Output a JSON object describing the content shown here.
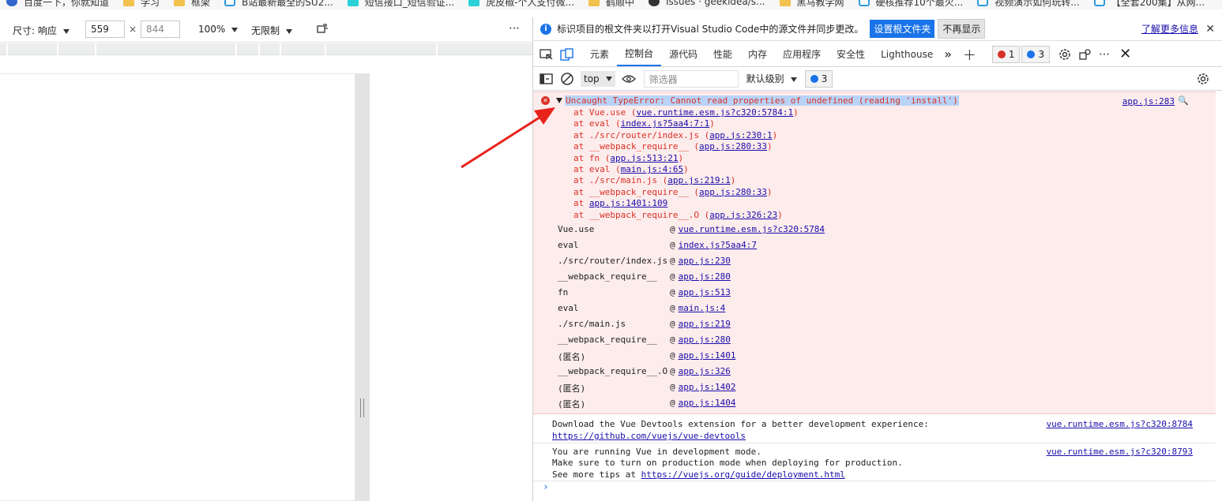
{
  "bookmarks": [
    "百度一下，你就知道",
    "学习",
    "框架",
    "B站最新最全的SU2...",
    "短信接口_短信验证...",
    "虎皮椒-个人支付微...",
    "鹤顺中",
    "Issues · geekidea/s...",
    "黑马教学网",
    "硬核推荐10个最火...",
    "视频演示如何玩转...",
    "【全套200集】从网..."
  ],
  "emulation": {
    "size_label": "尺寸: 响应",
    "width_value": "559",
    "times": "×",
    "height_placeholder": "844",
    "zoom": "100%",
    "throttle": "无限制"
  },
  "info_bar": {
    "message": "标识项目的根文件夹以打开Visual Studio Code中的源文件并同步更改。",
    "set_root_button": "设置根文件夹",
    "dismiss_button": "不再显示",
    "learn_more": "了解更多信息",
    "close": "✕"
  },
  "tabs": [
    "元素",
    "控制台",
    "源代码",
    "性能",
    "内存",
    "应用程序",
    "安全性",
    "Lighthouse"
  ],
  "active_tab": "控制台",
  "badges": {
    "errors": "1",
    "issues": "3"
  },
  "filter_bar": {
    "context": "top",
    "filter_placeholder": "筛选器",
    "level": "默认级别",
    "issues_count": "3"
  },
  "console": {
    "error_message": "Uncaught TypeError: Cannot read properties of undefined (reading 'install')",
    "error_source": "app.js:283",
    "trace": [
      {
        "pre": "at Vue.use (",
        "link": "vue.runtime.esm.js?c320:5784:1",
        "post": ")"
      },
      {
        "pre": "at eval (",
        "link": "index.js?5aa4:7:1",
        "post": ")"
      },
      {
        "pre": "at ./src/router/index.js (",
        "link": "app.js:230:1",
        "post": ")"
      },
      {
        "pre": "at __webpack_require__ (",
        "link": "app.js:280:33",
        "post": ")"
      },
      {
        "pre": "at fn (",
        "link": "app.js:513:21",
        "post": ")"
      },
      {
        "pre": "at eval (",
        "link": "main.js:4:65",
        "post": ")"
      },
      {
        "pre": "at ./src/main.js (",
        "link": "app.js:219:1",
        "post": ")"
      },
      {
        "pre": "at __webpack_require__ (",
        "link": "app.js:280:33",
        "post": ")"
      },
      {
        "pre": "at ",
        "link": "app.js:1401:109",
        "post": ""
      },
      {
        "pre": "at __webpack_require__.O (",
        "link": "app.js:326:23",
        "post": ")"
      }
    ],
    "stack": [
      {
        "fn": "Vue.use",
        "loc": "vue.runtime.esm.js?c320:5784"
      },
      {
        "fn": "eval",
        "loc": "index.js?5aa4:7"
      },
      {
        "fn": "./src/router/index.js",
        "loc": "app.js:230"
      },
      {
        "fn": "__webpack_require__",
        "loc": "app.js:280"
      },
      {
        "fn": "fn",
        "loc": "app.js:513"
      },
      {
        "fn": "eval",
        "loc": "main.js:4"
      },
      {
        "fn": "./src/main.js",
        "loc": "app.js:219"
      },
      {
        "fn": "__webpack_require__",
        "loc": "app.js:280"
      },
      {
        "fn": "(匿名)",
        "loc": "app.js:1401"
      },
      {
        "fn": "__webpack_require__.O",
        "loc": "app.js:326"
      },
      {
        "fn": "(匿名)",
        "loc": "app.js:1402"
      },
      {
        "fn": "(匿名)",
        "loc": "app.js:1404"
      }
    ],
    "log1_line1": "Download the Vue Devtools extension for a better development experience:",
    "log1_link": "https://github.com/vuejs/vue-devtools",
    "log1_source": "vue.runtime.esm.js?c320:8784",
    "log2_line1": "You are running Vue in development mode.",
    "log2_line2": "Make sure to turn on production mode when deploying for production.",
    "log2_line3_pre": "See more tips at ",
    "log2_link": "https://vuejs.org/guide/deployment.html",
    "log2_source": "vue.runtime.esm.js?c320:8793",
    "prompt": "›"
  },
  "colors": {
    "error_red": "#d93025",
    "link_blue": "#1a0dab",
    "accent_blue": "#1a73e8",
    "arrow_red": "#e8231c"
  }
}
